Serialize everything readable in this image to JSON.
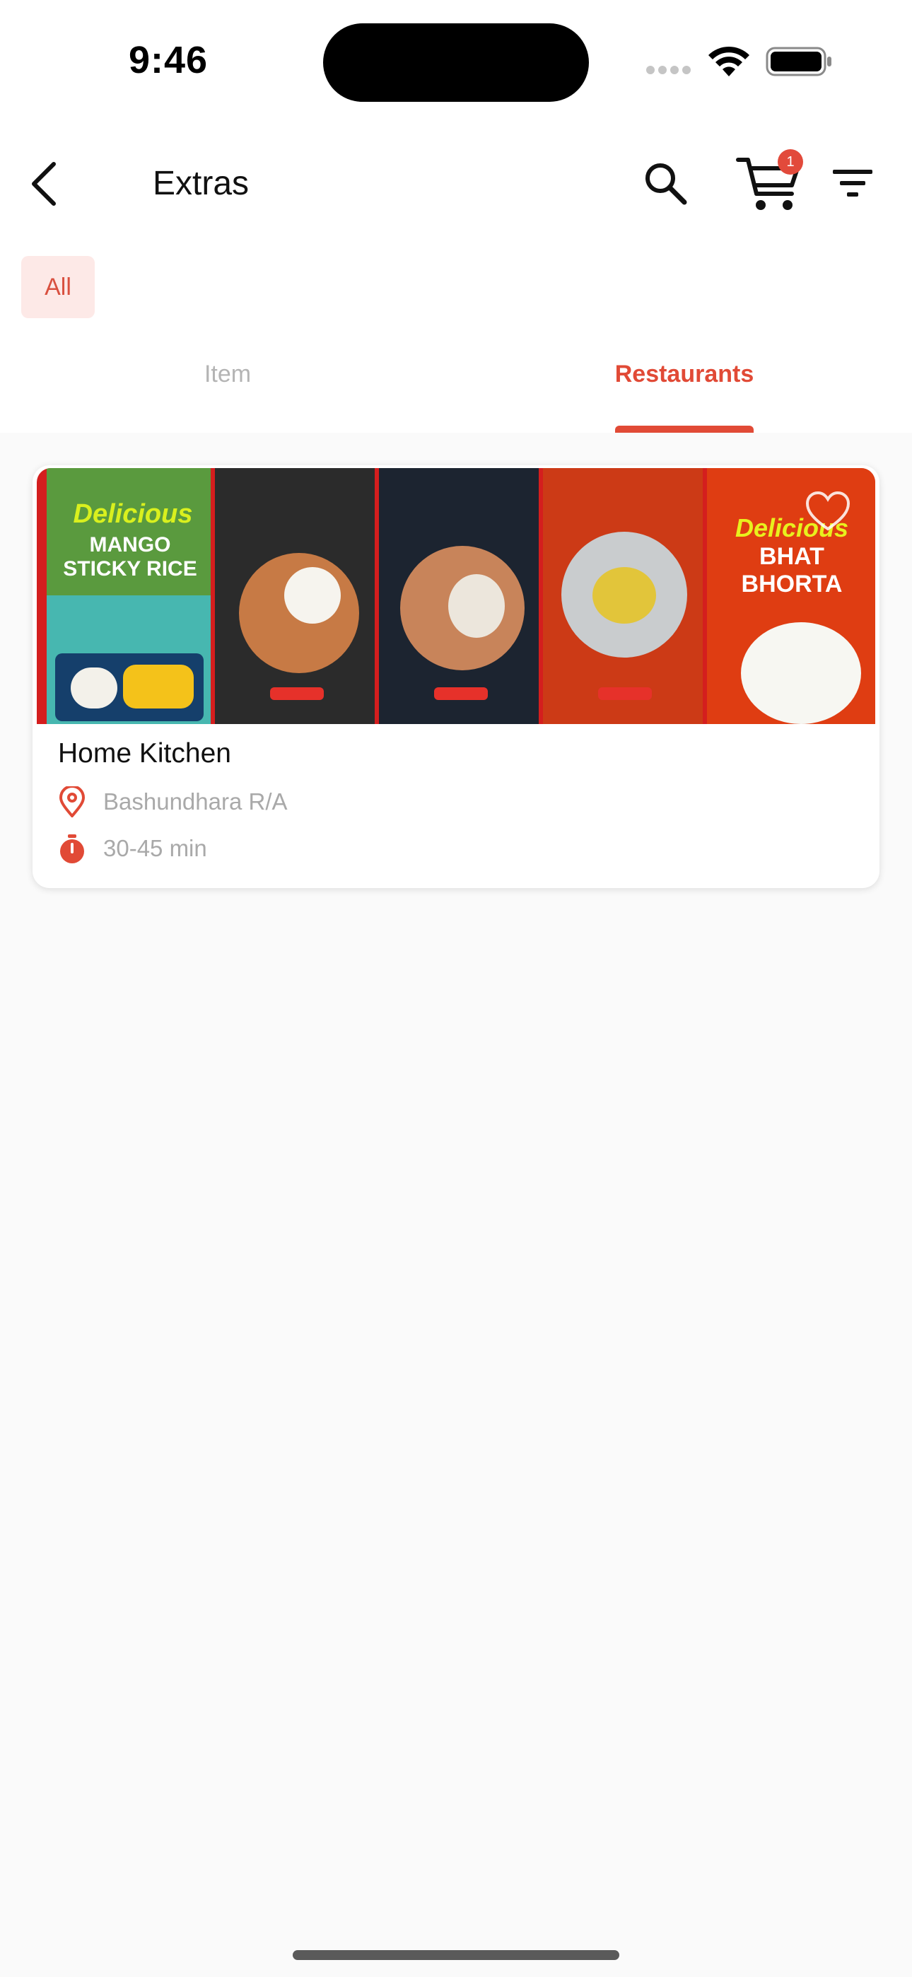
{
  "status_bar": {
    "time": "9:46"
  },
  "header": {
    "title": "Extras",
    "cart_badge": "1",
    "icons": [
      "back-arrow-icon",
      "search-icon",
      "cart-icon",
      "filter-icon"
    ]
  },
  "chips": [
    {
      "label": "All",
      "selected": true
    }
  ],
  "tabs": [
    {
      "label": "Item",
      "active": false
    },
    {
      "label": "Restaurants",
      "active": true
    }
  ],
  "restaurants": [
    {
      "name": "Home Kitchen",
      "location": "Bashundhara R/A",
      "delivery_time": "30-45 min",
      "banner": {
        "headline_1": "Delicious",
        "headline_1_sub": "MANGO STICKY RICE",
        "headline_2": "Delicious",
        "headline_2_sub": "BHAT BHORTA"
      }
    }
  ],
  "colors": {
    "accent": "#e14a36",
    "chip_bg": "#fde9e7",
    "muted_text": "#a9a9a9",
    "background": "#fafafa"
  }
}
